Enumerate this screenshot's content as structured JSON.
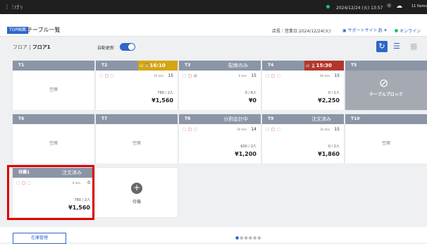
{
  "topbar": {
    "app_name": "ｱﾌﾟﾘ",
    "datetime": "2024/12/24 (火) 13:57",
    "rest_label": "11 Items"
  },
  "header": {
    "top_badge": "TOP画面",
    "title": "テーブル一覧",
    "store_info": "店長｜営業日:2024/12/24(火)",
    "support": "サポートサイト",
    "lang": "あ",
    "online": "オンライン"
  },
  "subheader": {
    "floor_label": "フロア",
    "floor_value": "フロア1",
    "auto_update": "自動更新"
  },
  "colors": {
    "accent": "#2f66c9",
    "lo_yellow": "#d4a514",
    "lo_red": "#b5352d",
    "header_gray": "#8b95a6",
    "highlight": "#e00000"
  },
  "tables": [
    {
      "num": "T1",
      "empty": "空席"
    },
    {
      "num": "T2",
      "lo_prefix": "LO",
      "lo_time": "16:10",
      "time": "10 min",
      "count": "15",
      "people": "780 / 2人",
      "amount": "¥1,560"
    },
    {
      "num": "T3",
      "status": "配席のみ",
      "time": "0 min",
      "count": "15",
      "people": "0 / 6人",
      "amount": "¥0"
    },
    {
      "num": "T4",
      "lo_prefix": "LO",
      "lo_time": "15:30",
      "time": "40 min",
      "count": "15",
      "people": "0 / 2人",
      "amount": "¥2,250"
    },
    {
      "num": "T5",
      "block_label": "テーブルブロック"
    },
    {
      "num": "T6",
      "empty": "空席"
    },
    {
      "num": "T7",
      "empty": "空席"
    },
    {
      "num": "T8",
      "status": "分割会計中",
      "time": "10 min",
      "count": "14",
      "people": "600 / 2人",
      "amount": "¥1,200"
    },
    {
      "num": "T9",
      "status": "注文済み",
      "time": "10 min",
      "count": "15",
      "people": "0 / 2人",
      "amount": "¥1,860"
    },
    {
      "num": "T10",
      "empty": "空席"
    }
  ],
  "waiting": {
    "num": "待機1",
    "status": "注文済み",
    "time": "0 min",
    "count": "0",
    "people": "780 / 2人",
    "amount": "¥1,560"
  },
  "wait_add_label": "待機",
  "bottom": {
    "stock_button": "在庫管理"
  }
}
